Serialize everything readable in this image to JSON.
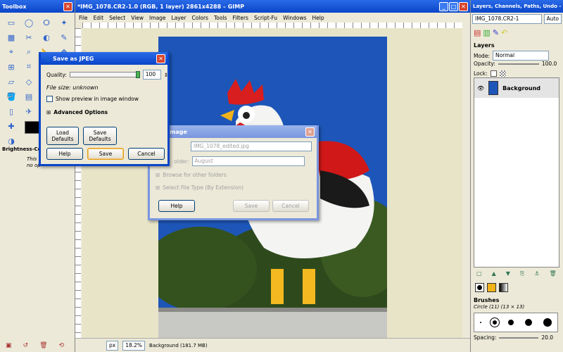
{
  "toolbox": {
    "title": "Toolbox",
    "brightness_label": "Brightness-Contr",
    "hint1": "This to",
    "hint2": "no op"
  },
  "main": {
    "title": "*IMG_1078.CR2-1.0 (RGB, 1 layer) 2861x4288 – GIMP",
    "menu": [
      "File",
      "Edit",
      "Select",
      "View",
      "Image",
      "Layer",
      "Colors",
      "Tools",
      "Filters",
      "Script-Fu",
      "Windows",
      "Help"
    ],
    "unit": "px",
    "zoom": "18.2%",
    "status": "Background (181.7 MB)"
  },
  "layers": {
    "title": "Layers, Channels, Paths, Undo - B...",
    "image_select": "IMG_1078.CR2-1",
    "auto": "Auto",
    "tab_label": "Layers",
    "mode_label": "Mode:",
    "mode": "Normal",
    "opacity_label": "Opacity:",
    "opacity": "100.0",
    "lock_label": "Lock:",
    "layer_name": "Background",
    "brushes_label": "Brushes",
    "brush_name": "Circle (11) (13 × 13)",
    "spacing_label": "Spacing:",
    "spacing": "20.0"
  },
  "jpeg": {
    "title": "Save as JPEG",
    "quality_label": "Quality:",
    "quality": "100",
    "quality_level": 1.0,
    "file_size": "File size: unknown",
    "preview": "Show preview in image window",
    "advanced": "Advanced Options",
    "load": "Load Defaults",
    "save_defaults": "Save Defaults",
    "help": "Help",
    "save": "Save",
    "cancel": "Cancel"
  },
  "saveimg": {
    "title": "Image",
    "name_value": "IMG_1078_edited.jpg",
    "folder_label": "older:",
    "folder": "August",
    "browse": "Browse for other folders",
    "filetype": "Select File Type (By Extension)",
    "help": "Help",
    "save": "Save",
    "cancel": "Cancel"
  }
}
